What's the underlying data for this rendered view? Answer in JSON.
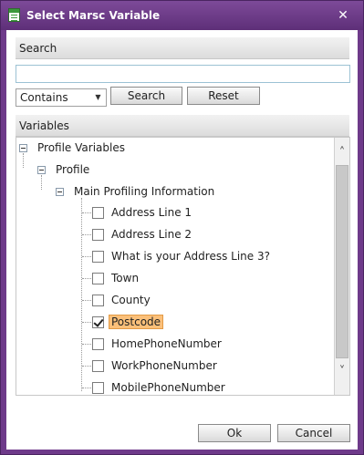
{
  "window": {
    "title": "Select Marsc Variable",
    "close_glyph": "✕"
  },
  "search": {
    "header": "Search",
    "value": "",
    "operator": "Contains",
    "search_label": "Search",
    "reset_label": "Reset"
  },
  "variables": {
    "header": "Variables",
    "root": "Profile Variables",
    "child": "Profile",
    "group": "Main Profiling Information",
    "items": [
      {
        "label": "Address Line 1",
        "checked": false,
        "selected": false
      },
      {
        "label": "Address Line 2",
        "checked": false,
        "selected": false
      },
      {
        "label": "What is your Address Line 3?",
        "checked": false,
        "selected": false
      },
      {
        "label": "Town",
        "checked": false,
        "selected": false
      },
      {
        "label": "County",
        "checked": false,
        "selected": false
      },
      {
        "label": "Postcode",
        "checked": true,
        "selected": true
      },
      {
        "label": "HomePhoneNumber",
        "checked": false,
        "selected": false
      },
      {
        "label": "WorkPhoneNumber",
        "checked": false,
        "selected": false
      },
      {
        "label": "MobilePhoneNumber",
        "checked": false,
        "selected": false
      }
    ]
  },
  "footer": {
    "ok_label": "Ok",
    "cancel_label": "Cancel"
  },
  "colors": {
    "titlebar": "#6e3a8a",
    "selected_bg": "#fbc07a"
  }
}
